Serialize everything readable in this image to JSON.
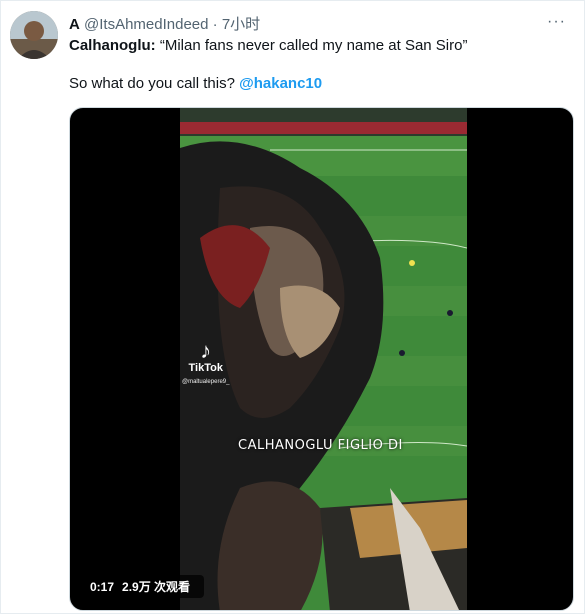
{
  "author": {
    "display_name": "A",
    "handle": "@ItsAhmedIndeed",
    "separator": "·",
    "time": "7小时"
  },
  "more_label": "···",
  "body": {
    "line1_bold": "Calhanoglu:",
    "line1_rest": " “Milan fans never called my name at San Siro”",
    "line2_text": "So what do you call this? ",
    "line2_mention": "@hakanc10"
  },
  "video": {
    "watermark_brand": "TikTok",
    "watermark_icon": "♪",
    "watermark_user": "@maltualepere9_",
    "caption": "CALHANOGLU FIGLIO DI",
    "time_elapsed": "0:17",
    "views": "2.9万 次观看"
  },
  "colors": {
    "link": "#1d9bf0",
    "pitch": "#3f8a3a",
    "flag_red": "#8a2a2a"
  }
}
